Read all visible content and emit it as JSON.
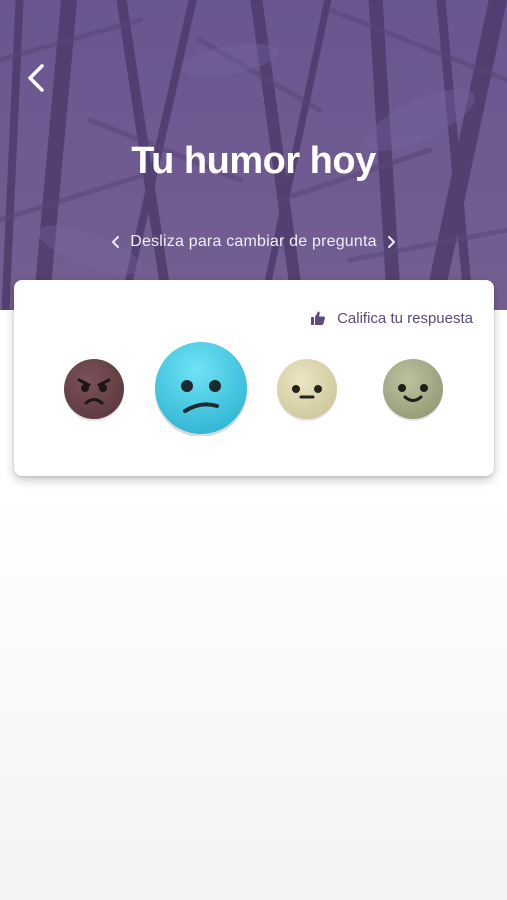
{
  "header": {
    "title": "Tu humor hoy",
    "swipe_hint": "Desliza para cambiar de pregunta",
    "back_icon": "chevron-left-icon"
  },
  "card": {
    "rate_label": "Califica tu respuesta",
    "rate_icon": "thumbs-up-icon",
    "moods": [
      {
        "icon": "angry-face-icon",
        "color": "#6b4548"
      },
      {
        "icon": "sad-face-icon",
        "color": "#3cc6e0",
        "selected": true
      },
      {
        "icon": "neutral-face-icon",
        "color": "#dcd6aa"
      },
      {
        "icon": "happy-face-icon",
        "color": "#a8b08a"
      }
    ]
  },
  "colors": {
    "header_bg": "#6f5a8f",
    "accent": "#5e4b7c"
  }
}
